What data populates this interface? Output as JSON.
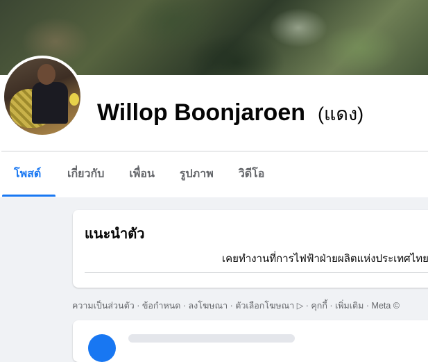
{
  "profile": {
    "name": "Willop Boonjaroen",
    "alternate_name": "(แดง)"
  },
  "tabs": [
    {
      "label": "โพสต์",
      "active": true
    },
    {
      "label": "เกี่ยวกับ",
      "active": false
    },
    {
      "label": "เพื่อน",
      "active": false
    },
    {
      "label": "รูปภาพ",
      "active": false
    },
    {
      "label": "วิดีโอ",
      "active": false
    }
  ],
  "intro": {
    "title": "แนะนำตัว",
    "bio": "เคยทำงานที่การไฟฟ้าฝ่ายผลิตแห่งประเทศไทย"
  },
  "footer": {
    "links": [
      "ความเป็นส่วนตัว",
      "ข้อกำหนด",
      "ลงโฆษณา",
      "ตัวเลือกโฆษณา ▷",
      "คุกกี้",
      "เพิ่มเติม",
      "Meta ©"
    ],
    "separator": " · "
  },
  "colors": {
    "accent": "#1877f2",
    "page_background": "#f0f2f5",
    "secondary_text": "#65676b"
  }
}
